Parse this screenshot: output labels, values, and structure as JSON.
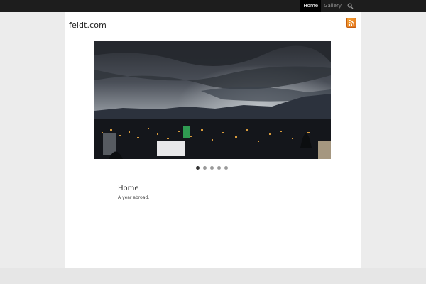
{
  "nav": {
    "items": [
      {
        "label": "Home",
        "active": true
      },
      {
        "label": "Gallery",
        "active": false
      }
    ],
    "search_icon": "search-icon"
  },
  "site": {
    "title": "feldt.com",
    "feed_icon": "rss-icon"
  },
  "slider": {
    "image": "night-city-landscape",
    "dot_count": 5,
    "active_index": 0
  },
  "page": {
    "heading": "Home",
    "description": "A year abroad."
  },
  "colors": {
    "topbar": "#1d1d1d",
    "nav_active_bg": "#000000",
    "page_bg": "#ececec",
    "panel_bg": "#ffffff",
    "rss": "#f7a534"
  }
}
